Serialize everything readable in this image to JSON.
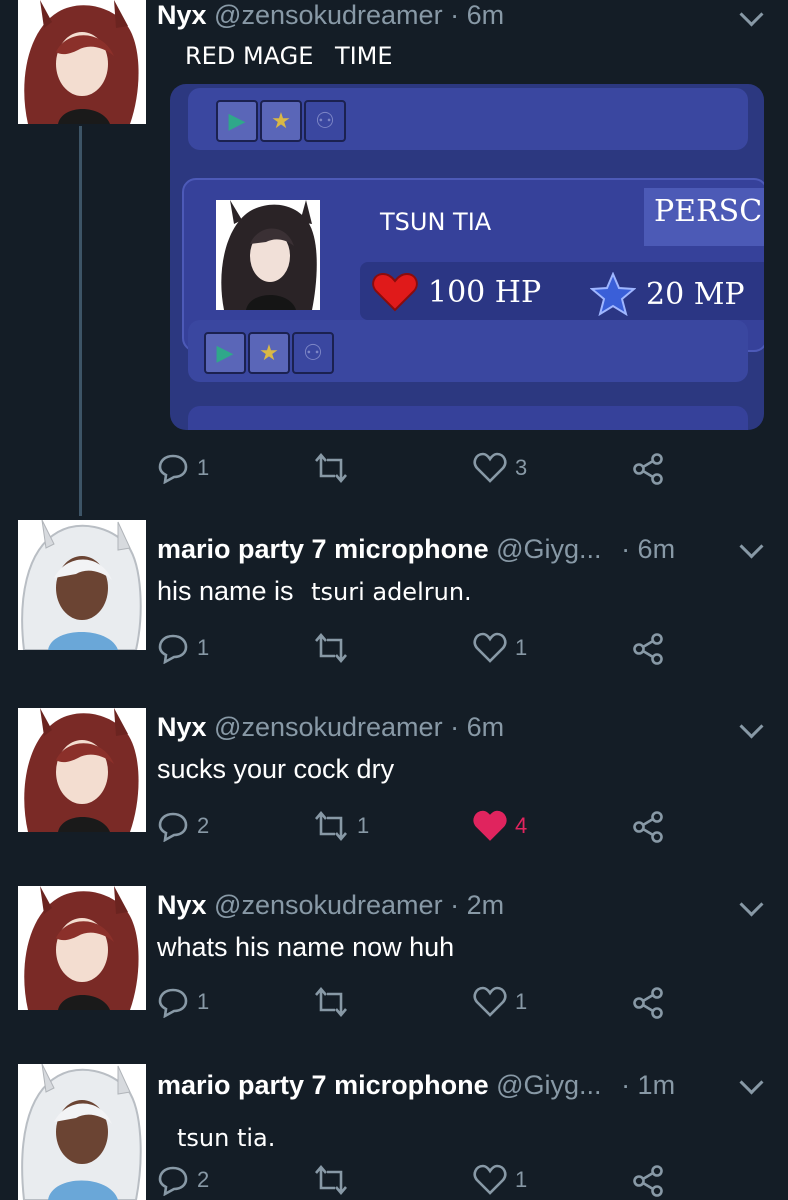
{
  "tweets": [
    {
      "name": "Nyx",
      "handle": "@zensokudreamer",
      "time": "· 6m",
      "text": "",
      "overlay_text": "RED MAGE",
      "overlay_text2": "TIME",
      "replies": "1",
      "retweets": "",
      "likes": "3",
      "liked": false,
      "embed": {
        "character_name": "TSUN TIA",
        "persona_label": "PERSC",
        "hp": "100 HP",
        "mp": "20 MP"
      }
    },
    {
      "name": "mario party 7 microphone",
      "handle": "@Giyg...",
      "time": "· 6m",
      "text": "his name is",
      "overlay_text": "tsuri adelrun.",
      "replies": "1",
      "retweets": "",
      "likes": "1",
      "liked": false
    },
    {
      "name": "Nyx",
      "handle": "@zensokudreamer",
      "time": "· 6m",
      "text": "sucks your cock dry",
      "replies": "2",
      "retweets": "1",
      "likes": "4",
      "liked": true
    },
    {
      "name": "Nyx",
      "handle": "@zensokudreamer",
      "time": "· 2m",
      "text": "whats his name now huh",
      "replies": "1",
      "retweets": "",
      "likes": "1",
      "liked": false
    },
    {
      "name": "mario party 7 microphone",
      "handle": "@Giyg...",
      "time": "· 1m",
      "text": "",
      "overlay_text": "tsun tia.",
      "replies": "2",
      "retweets": "",
      "likes": "1",
      "liked": false
    }
  ],
  "icons": {
    "reply": "reply-icon",
    "retweet": "retweet-icon",
    "like": "heart-icon",
    "share": "share-icon",
    "more": "chevron-down-icon",
    "play": "play-icon",
    "favorite": "star-icon",
    "party": "party-icon",
    "hp": "heart-icon",
    "mp": "star-icon"
  },
  "colors": {
    "background": "#141d26",
    "secondary_text": "#8899a6",
    "like_active": "#e0245e",
    "panel": "#2c3880"
  }
}
